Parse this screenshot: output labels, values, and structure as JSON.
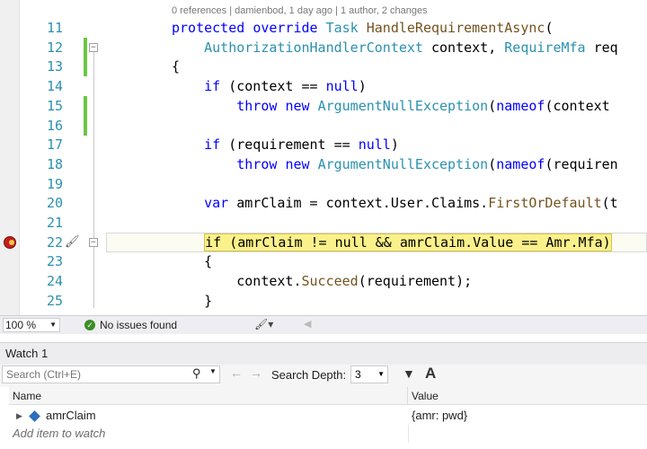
{
  "editor": {
    "codelens": "0 references | damienbod, 1 day ago | 1 author, 2 changes",
    "lines": [
      {
        "num": "11",
        "tokens": [
          [
            "kw",
            "protected"
          ],
          [
            "t",
            " "
          ],
          [
            "kw",
            "override"
          ],
          [
            "t",
            " "
          ],
          [
            "ty",
            "Task"
          ],
          [
            "t",
            " "
          ],
          [
            "fn",
            "HandleRequirementAsync"
          ],
          [
            "t",
            "("
          ]
        ]
      },
      {
        "num": "12",
        "tokens": [
          [
            "t",
            "    "
          ],
          [
            "ty",
            "AuthorizationHandlerContext"
          ],
          [
            "t",
            " context, "
          ],
          [
            "ty",
            "RequireMfa"
          ],
          [
            "t",
            " req"
          ]
        ]
      },
      {
        "num": "13",
        "tokens": [
          [
            "t",
            "{"
          ]
        ]
      },
      {
        "num": "14",
        "tokens": [
          [
            "t",
            "    "
          ],
          [
            "kw",
            "if"
          ],
          [
            "t",
            " (context == "
          ],
          [
            "kw",
            "null"
          ],
          [
            "t",
            ")"
          ]
        ]
      },
      {
        "num": "15",
        "tokens": [
          [
            "t",
            "        "
          ],
          [
            "kw",
            "throw"
          ],
          [
            "t",
            " "
          ],
          [
            "kw",
            "new"
          ],
          [
            "t",
            " "
          ],
          [
            "ty",
            "ArgumentNullException"
          ],
          [
            "t",
            "("
          ],
          [
            "kw",
            "nameof"
          ],
          [
            "t",
            "(context"
          ]
        ]
      },
      {
        "num": "16",
        "tokens": []
      },
      {
        "num": "17",
        "tokens": [
          [
            "t",
            "    "
          ],
          [
            "kw",
            "if"
          ],
          [
            "t",
            " (requirement == "
          ],
          [
            "kw",
            "null"
          ],
          [
            "t",
            ")"
          ]
        ]
      },
      {
        "num": "18",
        "tokens": [
          [
            "t",
            "        "
          ],
          [
            "kw",
            "throw"
          ],
          [
            "t",
            " "
          ],
          [
            "kw",
            "new"
          ],
          [
            "t",
            " "
          ],
          [
            "ty",
            "ArgumentNullException"
          ],
          [
            "t",
            "("
          ],
          [
            "kw",
            "nameof"
          ],
          [
            "t",
            "(requiren"
          ]
        ]
      },
      {
        "num": "19",
        "tokens": []
      },
      {
        "num": "20",
        "tokens": [
          [
            "t",
            "    "
          ],
          [
            "kw",
            "var"
          ],
          [
            "t",
            " amrClaim = context.User.Claims."
          ],
          [
            "fn",
            "FirstOrDefault"
          ],
          [
            "t",
            "(t"
          ]
        ]
      },
      {
        "num": "21",
        "tokens": []
      },
      {
        "num": "22",
        "tokens": [
          [
            "t",
            "    "
          ],
          [
            "hl",
            "if (amrClaim != null && amrClaim.Value == Amr.Mfa)"
          ]
        ]
      },
      {
        "num": "23",
        "tokens": [
          [
            "t",
            "    {"
          ]
        ]
      },
      {
        "num": "24",
        "tokens": [
          [
            "t",
            "        context."
          ],
          [
            "fn",
            "Succeed"
          ],
          [
            "t",
            "(requirement);"
          ]
        ]
      },
      {
        "num": "25",
        "tokens": [
          [
            "t",
            "    }"
          ]
        ]
      }
    ]
  },
  "status": {
    "zoom": "100 %",
    "issues": "No issues found"
  },
  "watch": {
    "title": "Watch 1",
    "search_placeholder": "Search (Ctrl+E)",
    "depth_label": "Search Depth:",
    "depth_value": "3",
    "col_name": "Name",
    "col_value": "Value",
    "rows": [
      {
        "name": "amrClaim",
        "value": "{amr: pwd}"
      }
    ],
    "add_item": "Add item to watch"
  }
}
